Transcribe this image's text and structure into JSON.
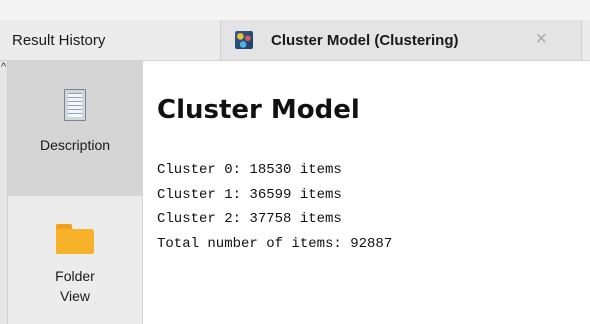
{
  "tabs": {
    "history_label": "Result History",
    "active_label": "Cluster Model (Clustering)",
    "close_symbol": "×",
    "active_icon": "cluster-model-icon"
  },
  "sidebar": {
    "items": [
      {
        "label": "Description",
        "icon": "document-icon"
      },
      {
        "label": "Folder",
        "label2": "View",
        "icon": "folder-icon"
      }
    ]
  },
  "main": {
    "title": "Cluster Model",
    "lines": [
      "Cluster 0: 18530 items",
      "Cluster 1: 36599 items",
      "Cluster 2: 37758 items",
      "Total number of items: 92887"
    ]
  },
  "colors": {
    "tab_bar": "#ececec",
    "sidebar_selected": "#d5d5d5",
    "folder": "#f7b22a"
  }
}
